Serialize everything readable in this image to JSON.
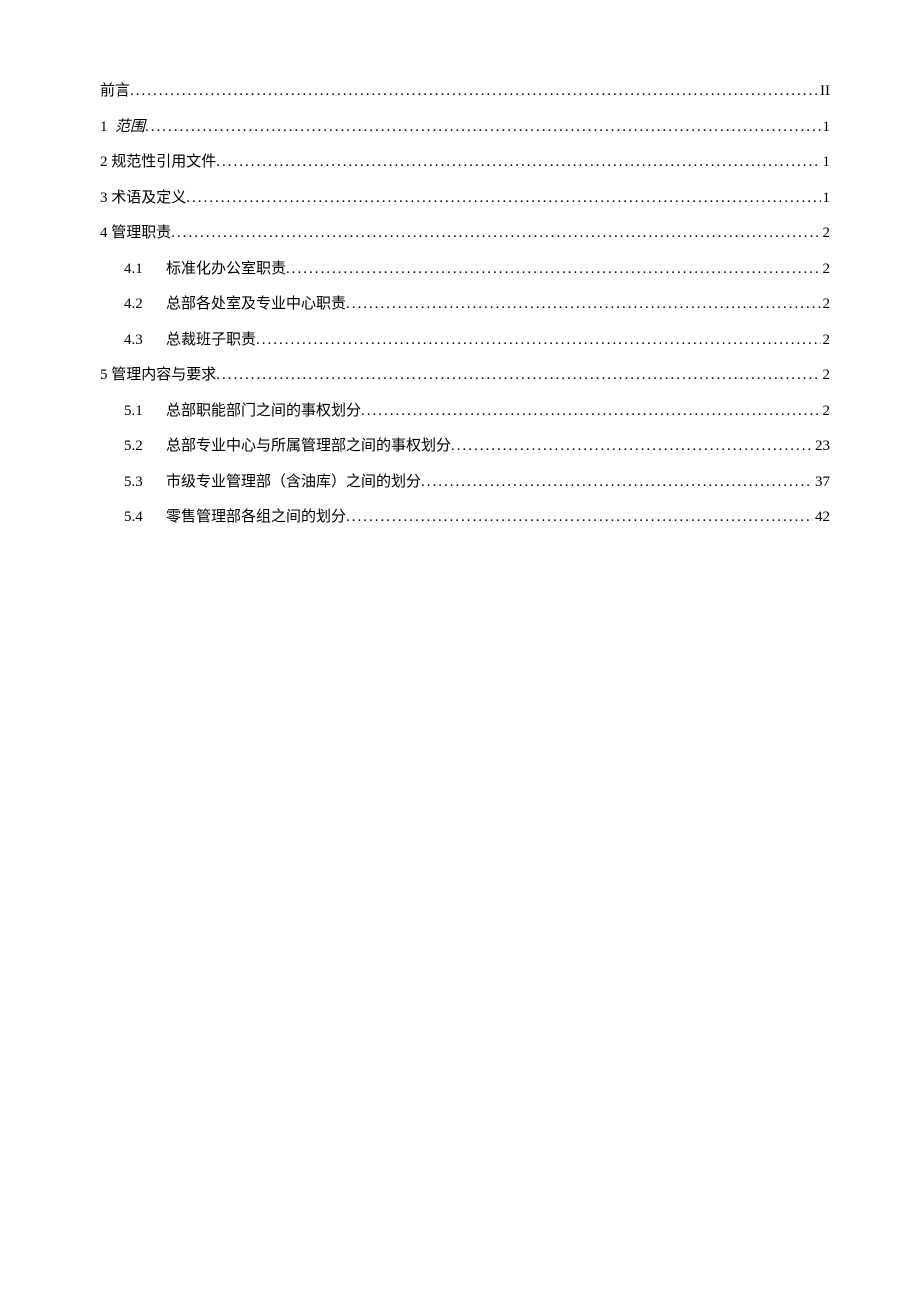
{
  "toc": {
    "entries": [
      {
        "label": "前言",
        "page": "II",
        "level": 1
      },
      {
        "num": "1",
        "label": "范围",
        "page": "1",
        "level": 1,
        "italic": true
      },
      {
        "num": "2",
        "label": "规范性引用文件",
        "page": "1",
        "level": 1
      },
      {
        "num": "3",
        "label": "术语及定义",
        "page": "1",
        "level": 1
      },
      {
        "num": "4",
        "label": "管理职责",
        "page": "2",
        "level": 1
      },
      {
        "num": "4.1",
        "label": "标准化办公室职责",
        "page": "2",
        "level": 2
      },
      {
        "num": "4.2",
        "label": "总部各处室及专业中心职责",
        "page": "2",
        "level": 2
      },
      {
        "num": "4.3",
        "label": "总裁班子职责",
        "page": "2",
        "level": 2
      },
      {
        "num": "5",
        "label": "管理内容与要求",
        "page": "2",
        "level": 1
      },
      {
        "num": "5.1",
        "label": "总部职能部门之间的事权划分",
        "page": "2",
        "level": 2
      },
      {
        "num": "5.2",
        "label": "总部专业中心与所属管理部之间的事权划分",
        "page": "23",
        "level": 2
      },
      {
        "num": "5.3",
        "label": "市级专业管理部（含油库）之间的划分",
        "page": "37",
        "level": 2
      },
      {
        "num": "5.4",
        "label": "零售管理部各组之间的划分",
        "page": "42",
        "level": 2
      }
    ]
  }
}
